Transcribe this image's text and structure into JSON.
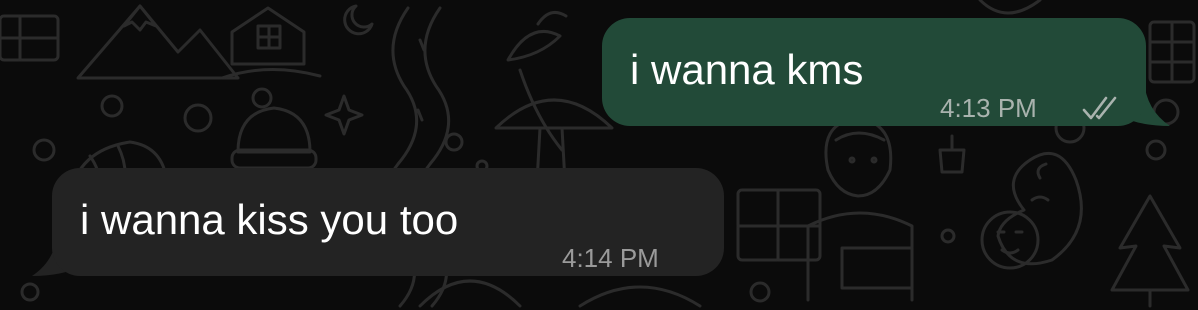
{
  "colors": {
    "background": "#0b0b0b",
    "outgoing_bubble": "#224a38",
    "incoming_bubble": "#232323",
    "doodle": "#2a2a2a",
    "message_text": "#ffffff",
    "timestamp_text": "#a9b3ae",
    "read_ticks": "#a9b3ae"
  },
  "messages": [
    {
      "direction": "outgoing",
      "text": "i wanna kms",
      "time": "4:13 PM",
      "status_icon": "double-check-icon"
    },
    {
      "direction": "incoming",
      "text": "i wanna kiss you too",
      "time": "4:14 PM"
    }
  ]
}
